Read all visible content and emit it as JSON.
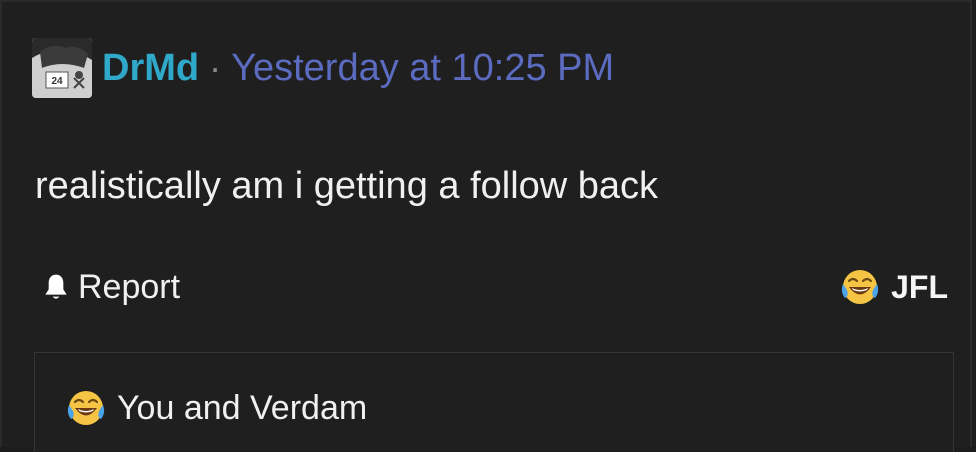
{
  "post": {
    "username": "DrMd",
    "separator": "·",
    "timestamp": "Yesterday at 10:25 PM",
    "message": "realistically am i getting a follow back",
    "avatar_badge": "24"
  },
  "actions": {
    "report_label": "Report",
    "reaction_label": "JFL",
    "reaction_icon": "laughing-crying-emoji-icon"
  },
  "reactions_summary": {
    "text": "You and Verdam",
    "icon": "laughing-crying-emoji-icon"
  },
  "colors": {
    "username": "#2fa8c9",
    "timestamp": "#5b6bc0",
    "background": "#1f1f1f",
    "text": "#f0f0f0"
  }
}
